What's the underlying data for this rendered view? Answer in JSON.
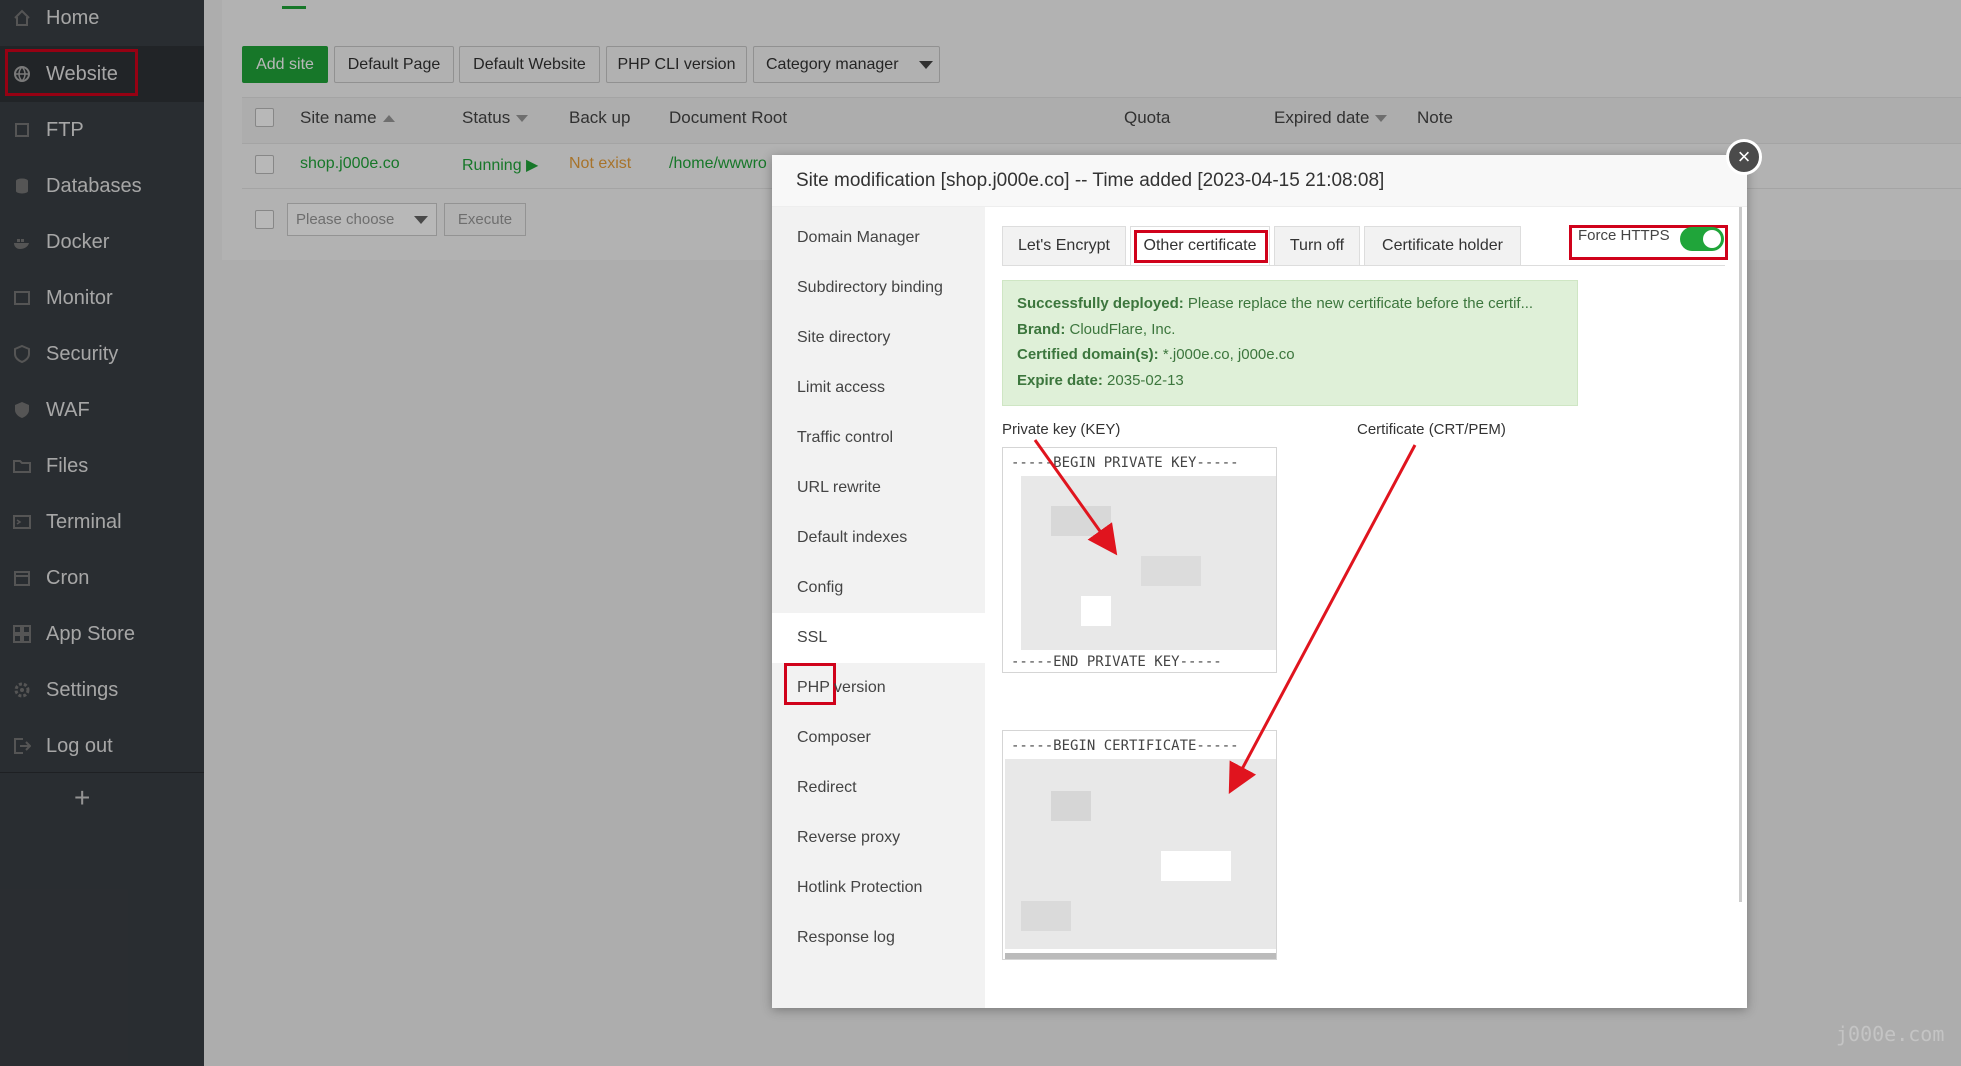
{
  "sidebar": {
    "items": [
      {
        "label": "Home",
        "icon": "home-icon"
      },
      {
        "label": "Website",
        "icon": "globe-icon"
      },
      {
        "label": "FTP",
        "icon": "ftp-icon"
      },
      {
        "label": "Databases",
        "icon": "database-icon"
      },
      {
        "label": "Docker",
        "icon": "docker-icon"
      },
      {
        "label": "Monitor",
        "icon": "monitor-icon"
      },
      {
        "label": "Security",
        "icon": "shield-icon"
      },
      {
        "label": "WAF",
        "icon": "waf-icon"
      },
      {
        "label": "Files",
        "icon": "folder-icon"
      },
      {
        "label": "Terminal",
        "icon": "terminal-icon"
      },
      {
        "label": "Cron",
        "icon": "calendar-icon"
      },
      {
        "label": "App Store",
        "icon": "grid-icon"
      },
      {
        "label": "Settings",
        "icon": "gear-icon"
      },
      {
        "label": "Log out",
        "icon": "logout-icon"
      }
    ],
    "active": "Website",
    "add_symbol": "+"
  },
  "toolbar": {
    "add_site": "Add site",
    "default_page": "Default Page",
    "default_website": "Default Website",
    "php_cli": "PHP CLI version",
    "category_manager": "Category manager"
  },
  "table": {
    "headers": [
      "Site name",
      "Status",
      "Back up",
      "Document Root",
      "Quota",
      "Expired date",
      "Note"
    ],
    "row": {
      "site": "shop.j000e.co",
      "status": "Running",
      "backup": "Not exist",
      "root": "/home/wwwro"
    },
    "batch_placeholder": "Please choose",
    "execute": "Execute"
  },
  "modal": {
    "title": "Site modification [shop.j000e.co] -- Time added [2023-04-15 21:08:08]",
    "close_symbol": "×",
    "side_items": [
      "Domain Manager",
      "Subdirectory binding",
      "Site directory",
      "Limit access",
      "Traffic control",
      "URL rewrite",
      "Default indexes",
      "Config",
      "SSL",
      "PHP version",
      "Composer",
      "Redirect",
      "Reverse proxy",
      "Hotlink Protection",
      "Response log"
    ],
    "active_side": "SSL",
    "tabs": [
      "Let's Encrypt",
      "Other certificate",
      "Turn off",
      "Certificate holder"
    ],
    "active_tab": "Other certificate",
    "force_https": {
      "label": "Force HTTPS",
      "on": true
    },
    "success": {
      "deployed_label": "Successfully deployed:",
      "deployed_text": "Please replace the new certificate before the certif...",
      "brand_label": "Brand:",
      "brand": "CloudFlare, Inc.",
      "domains_label": "Certified domain(s):",
      "domains": "*.j000e.co, j000e.co",
      "expire_label": "Expire date:",
      "expire": "2035-02-13"
    },
    "private_key_label": "Private key (KEY)",
    "certificate_label": "Certificate (CRT/PEM)",
    "key_begin": "-----BEGIN PRIVATE KEY-----",
    "key_end": "-----END PRIVATE KEY-----",
    "cert_begin": "-----BEGIN CERTIFICATE-----"
  },
  "watermark": "j000e.com",
  "colors": {
    "accent": "#20a53a",
    "highlight": "#d0021b",
    "sidebar": "#3a3f44"
  }
}
